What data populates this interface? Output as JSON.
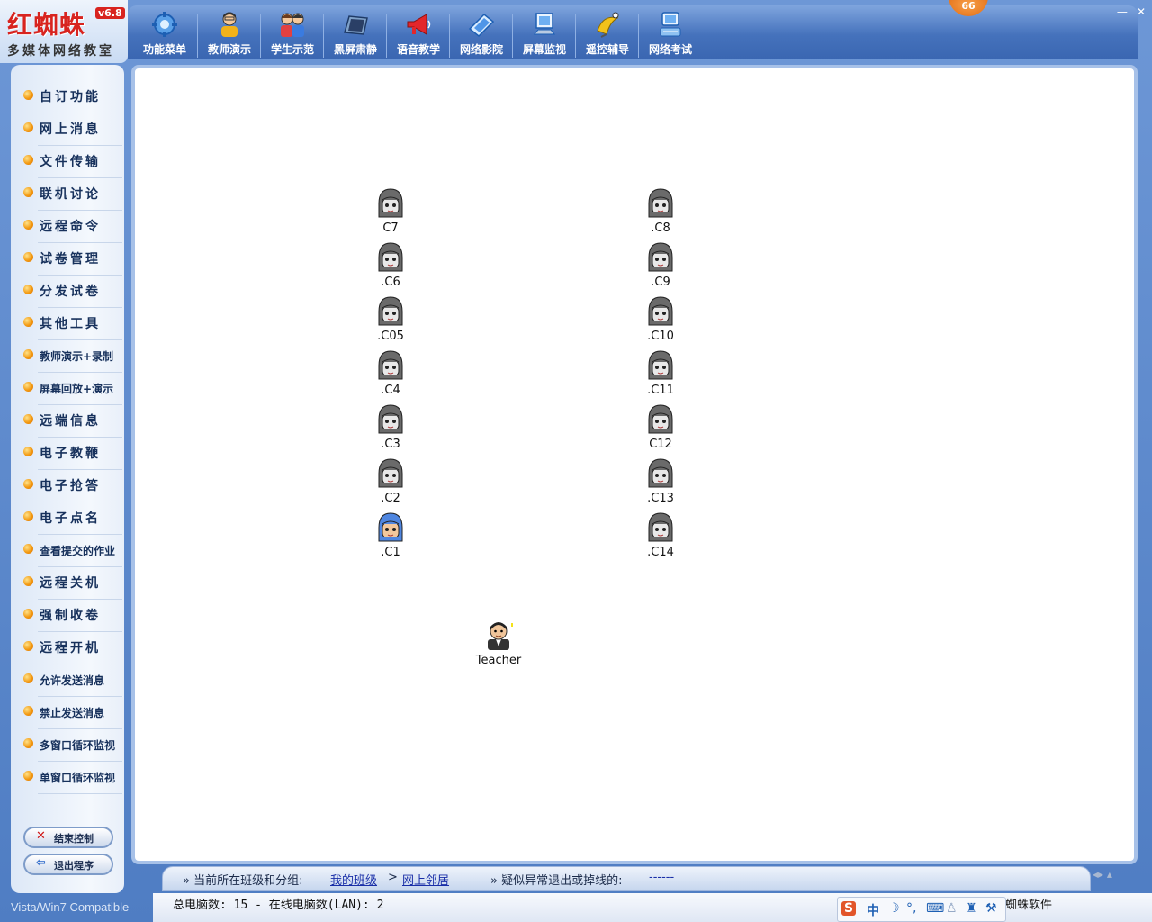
{
  "logo": {
    "title": "红蜘蛛",
    "version": "v6.8",
    "subtitle": "多媒体网络教室"
  },
  "badge": "66",
  "window_controls": {
    "minimize": "—",
    "close": "✕"
  },
  "toolbar": [
    {
      "label": "功能菜单",
      "icon": "gear-icon"
    },
    {
      "label": "教师演示",
      "icon": "teacher-icon"
    },
    {
      "label": "学生示范",
      "icon": "students-icon"
    },
    {
      "label": "黑屏肃静",
      "icon": "black-screen-icon"
    },
    {
      "label": "语音教学",
      "icon": "megaphone-icon"
    },
    {
      "label": "网络影院",
      "icon": "cinema-icon"
    },
    {
      "label": "屏幕监视",
      "icon": "monitor-icon"
    },
    {
      "label": "遥控辅导",
      "icon": "remote-icon"
    },
    {
      "label": "网络考试",
      "icon": "exam-icon"
    }
  ],
  "sidebar": {
    "items": [
      "自订功能",
      "网上消息",
      "文件传输",
      "联机讨论",
      "远程命令",
      "试卷管理",
      "分发试卷",
      "其他工具",
      "教师演示+录制",
      "屏幕回放+演示",
      "远端信息",
      "电子教鞭",
      "电子抢答",
      "电子点名",
      "查看提交的作业",
      "远程关机",
      "强制收卷",
      "远程开机",
      "允许发送消息",
      "禁止发送消息",
      "多窗口循环监视",
      "单窗口循环监视"
    ],
    "end_control": "结束控制",
    "exit_program": "退出程序",
    "compat": "Vista/Win7 Compatible"
  },
  "computers": {
    "left": [
      "C7",
      ".C6",
      ".C05",
      ".C4",
      ".C3",
      ".C2",
      ".C1"
    ],
    "right": [
      ".C8",
      ".C9",
      ".C10",
      ".C11",
      "C12",
      ".C13",
      ".C14"
    ],
    "online": [
      ".C1"
    ],
    "teacher": "Teacher"
  },
  "bottom": {
    "prefix": "» 当前所在班级和分组:",
    "class_link": "我的班级",
    "arrow": ">",
    "group_link": "网上邻居",
    "abnormal_label": "» 疑似异常退出或掉线的:",
    "abnormal_value": "------"
  },
  "status": {
    "total": "总电脑数: 15  -  在线电脑数(LAN): 2",
    "brand": "红蜘蛛软件"
  }
}
